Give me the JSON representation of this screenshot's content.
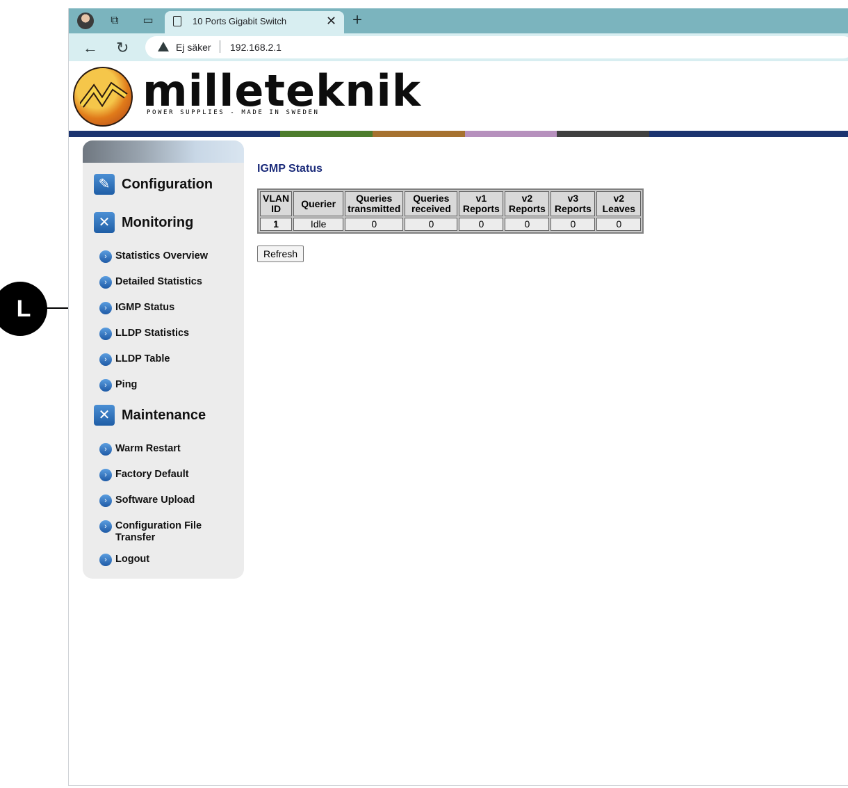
{
  "callout": {
    "label": "L"
  },
  "browser": {
    "tab_title": "10 Ports Gigabit Switch",
    "security_label": "Ej säker",
    "url": "192.168.2.1"
  },
  "logo": {
    "name": "milleteknik",
    "tagline": "POWER SUPPLIES - MADE IN SWEDEN"
  },
  "colorbar": [
    "#1c3470",
    "#4e7d2d",
    "#a67230",
    "#b690bd",
    "#404040",
    "#1c3470"
  ],
  "sidebar": {
    "sections": [
      {
        "label": "Configuration",
        "icon": "configuration-icon"
      },
      {
        "label": "Monitoring",
        "icon": "tools-icon"
      },
      {
        "label": "Maintenance",
        "icon": "tools-icon"
      }
    ],
    "monitoring_items": [
      "Statistics Overview",
      "Detailed Statistics",
      "IGMP Status",
      "LLDP Statistics",
      "LLDP Table",
      "Ping"
    ],
    "maintenance_items": [
      "Warm Restart",
      "Factory Default",
      "Software Upload",
      "Configuration File Transfer",
      "Logout"
    ]
  },
  "main": {
    "title": "IGMP Status",
    "table": {
      "headers": [
        "VLAN ID",
        "Querier",
        "Queries transmitted",
        "Queries received",
        "v1 Reports",
        "v2 Reports",
        "v3 Reports",
        "v2 Leaves"
      ],
      "rows": [
        [
          "1",
          "Idle",
          "0",
          "0",
          "0",
          "0",
          "0",
          "0"
        ]
      ]
    },
    "refresh_label": "Refresh"
  }
}
